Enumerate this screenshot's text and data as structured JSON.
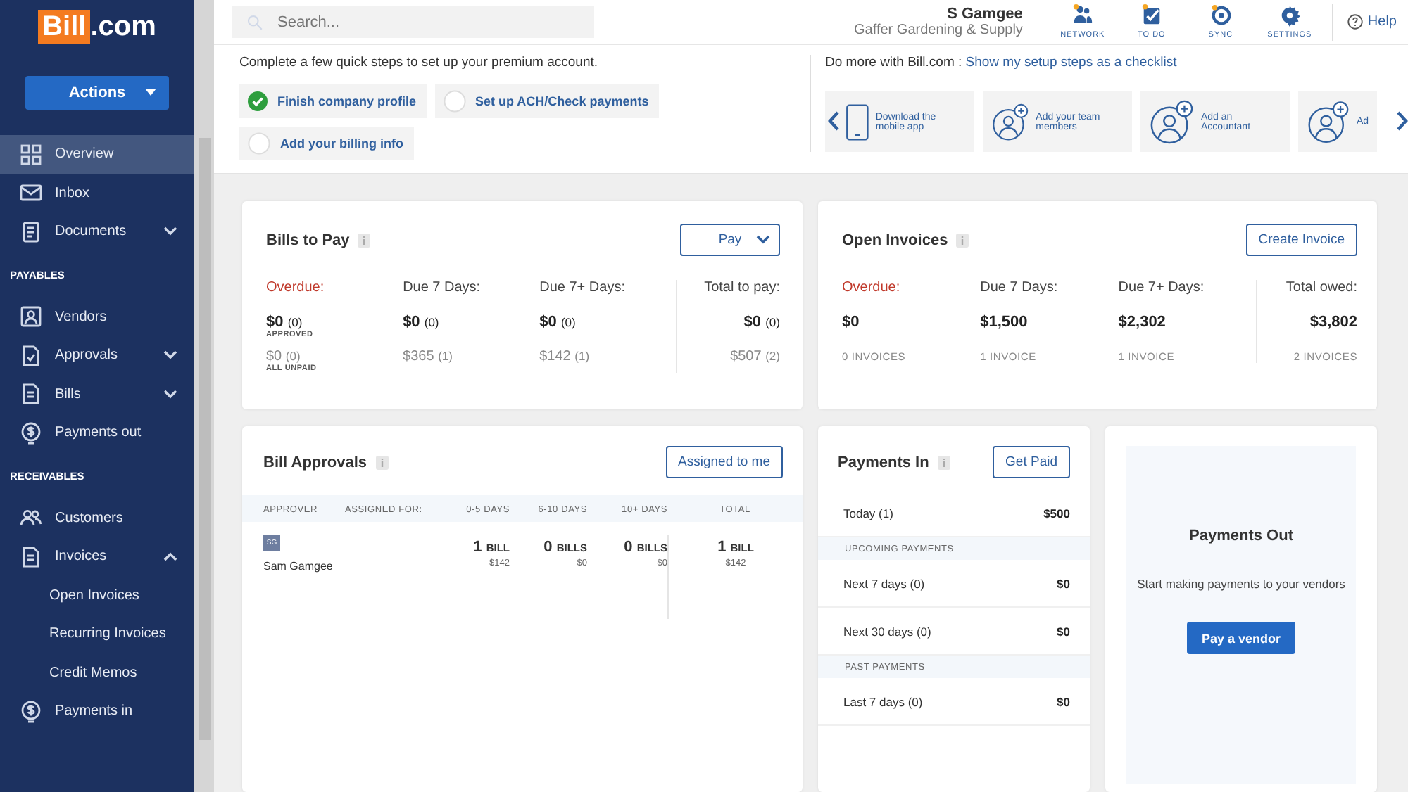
{
  "sidebar": {
    "logo": {
      "brand": "Bill",
      "suffix": ".com"
    },
    "actions_button": "Actions",
    "items": [
      {
        "kind": "item",
        "label": "Overview",
        "selected": true
      },
      {
        "kind": "item",
        "label": "Inbox",
        "selected": false
      },
      {
        "kind": "item",
        "label": "Documents",
        "selected": false,
        "expanded": false
      },
      {
        "kind": "section",
        "label": "PAYABLES"
      },
      {
        "kind": "item",
        "label": "Vendors",
        "selected": false
      },
      {
        "kind": "item",
        "label": "Approvals",
        "selected": false,
        "expanded": false
      },
      {
        "kind": "item",
        "label": "Bills",
        "selected": false,
        "expanded": false
      },
      {
        "kind": "item",
        "label": "Payments out",
        "selected": false
      },
      {
        "kind": "section",
        "label": "RECEIVABLES"
      },
      {
        "kind": "item",
        "label": "Customers",
        "selected": false
      },
      {
        "kind": "item",
        "label": "Invoices",
        "selected": false,
        "expanded": true,
        "children": [
          {
            "label": "Open Invoices",
            "selected": false
          },
          {
            "label": "Recurring Invoices",
            "selected": false
          },
          {
            "label": "Credit Memos",
            "selected": false
          }
        ]
      },
      {
        "kind": "item",
        "label": "Payments in",
        "selected": false
      }
    ]
  },
  "header": {
    "search": {
      "placeholder": "Search..."
    },
    "user": {
      "name": "S Gamgee",
      "company": "Gaffer Gardening & Supply"
    },
    "tools": [
      {
        "label": "NETWORK"
      },
      {
        "label": "TO DO"
      },
      {
        "label": "SYNC"
      },
      {
        "label": "SETTINGS"
      }
    ],
    "help": "Help"
  },
  "setup": {
    "intro": "Complete a few quick steps to set up your premium account.",
    "steps": [
      {
        "label": "Finish company profile",
        "checked": true
      },
      {
        "label": "Set up ACH/Check payments",
        "checked": false
      },
      {
        "label": "Add your billing info",
        "checked": false
      }
    ],
    "more_label": "Do more with Bill.com :",
    "more_link": "Show my setup steps as a checklist",
    "cards": [
      {
        "kind": "phone",
        "label": "Download the mobile app"
      },
      {
        "kind": "person",
        "label": "Add your team members"
      },
      {
        "kind": "person",
        "label": "Add an Accountant"
      },
      {
        "kind": "person",
        "label": "Ad"
      }
    ]
  },
  "bills_to_pay": {
    "title": "Bills to Pay",
    "button": "Pay",
    "columns": [
      {
        "kind": "overdue",
        "label": "Overdue:",
        "amount": "$0",
        "count": "(0)",
        "note": "APPROVED",
        "amount_2": "$0",
        "count_2": "(0)",
        "note_2": "ALL UNPAID"
      },
      {
        "kind": "normal",
        "label": "Due 7 Days:",
        "amount": "$0",
        "count": "(0)",
        "amount_2": "$365",
        "count_2": "(1)"
      },
      {
        "kind": "normal",
        "label": "Due 7+ Days:",
        "amount": "$0",
        "count": "(0)",
        "amount_2": "$142",
        "count_2": "(1)"
      },
      {
        "kind": "total",
        "label": "Total to pay:",
        "amount": "$0",
        "count": "(0)",
        "amount_2": "$507",
        "count_2": "(2)"
      }
    ]
  },
  "open_invoices": {
    "title": "Open Invoices",
    "button": "Create Invoice",
    "columns": [
      {
        "kind": "overdue",
        "label": "Overdue:",
        "amount": "$0",
        "note": "0 INVOICES"
      },
      {
        "kind": "normal",
        "label": "Due 7 Days:",
        "amount": "$1,500",
        "note": "1 INVOICE"
      },
      {
        "kind": "normal",
        "label": "Due 7+ Days:",
        "amount": "$2,302",
        "note": "1 INVOICE"
      },
      {
        "kind": "total",
        "label": "Total owed:",
        "amount": "$3,802",
        "note": "2 INVOICES"
      }
    ]
  },
  "bill_approvals": {
    "title": "Bill Approvals",
    "button": "Assigned to me",
    "columns": [
      "APPROVER",
      "ASSIGNED FOR:",
      "0-5 DAYS",
      "6-10 DAYS",
      "10+ DAYS",
      "TOTAL"
    ],
    "rows": [
      {
        "cells": [
          {
            "kind": "approver",
            "initials": "SG",
            "name": "Sam Gamgee"
          },
          "",
          {
            "kind": "bills",
            "count": "1",
            "unit": "BILL",
            "amount": "$142"
          },
          {
            "kind": "bills",
            "count": "0",
            "unit": "BILLS",
            "amount": "$0"
          },
          {
            "kind": "bills",
            "count": "0",
            "unit": "BILLS",
            "amount": "$0"
          },
          {
            "kind": "bills",
            "count": "1",
            "unit": "BILL",
            "amount": "$142"
          }
        ]
      }
    ]
  },
  "payments_in": {
    "title": "Payments In",
    "button": "Get Paid",
    "rows": [
      {
        "kind": "row",
        "label": "Today (1)",
        "amount": "$500"
      },
      {
        "kind": "section",
        "label": "UPCOMING PAYMENTS"
      },
      {
        "kind": "row",
        "label": "Next 7 days (0)",
        "amount": "$0"
      },
      {
        "kind": "row",
        "label": "Next 30 days (0)",
        "amount": "$0"
      },
      {
        "kind": "section",
        "label": "PAST PAYMENTS"
      },
      {
        "kind": "row",
        "label": "Last 7 days (0)",
        "amount": "$0"
      }
    ]
  },
  "payments_out": {
    "title": "Payments Out",
    "text": "Start making payments to your vendors",
    "button": "Pay a vendor"
  }
}
